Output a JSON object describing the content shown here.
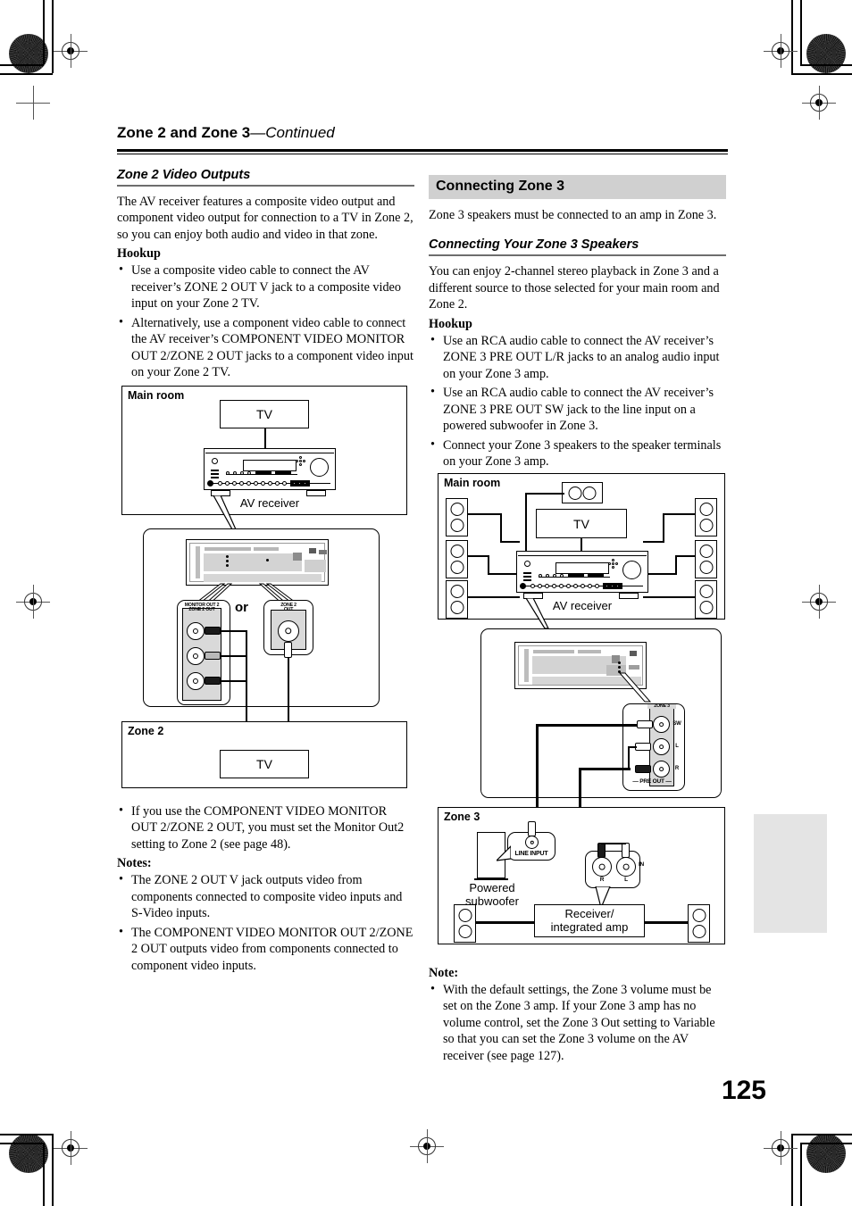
{
  "header": {
    "title_bold": "Zone 2 and Zone 3",
    "title_italic": "—Continued"
  },
  "left_column": {
    "section_title": "Zone 2 Video Outputs",
    "intro": "The AV receiver features a composite video output and component video output for connection to a TV in Zone 2, so you can enjoy both audio and video in that zone.",
    "hookup_label": "Hookup",
    "hookup_items": [
      "Use a composite video cable to connect the AV receiver’s ZONE 2 OUT V jack to a composite video input on your Zone 2 TV.",
      "Alternatively, use a component video cable to connect the AV receiver’s COMPONENT VIDEO MONITOR OUT 2/ZONE 2 OUT jacks to a component video input on your Zone 2 TV."
    ],
    "after_diagram_items": [
      "If you use the COMPONENT VIDEO MONITOR OUT 2/ZONE 2 OUT, you must set the Monitor Out2 setting to Zone 2 (see page 48)."
    ],
    "notes_label": "Notes:",
    "notes_items": [
      "The ZONE 2 OUT V jack outputs video from components connected to composite video inputs and S-Video inputs.",
      "The COMPONENT VIDEO MONITOR OUT 2/ZONE 2 OUT outputs video from components connected to component video inputs."
    ]
  },
  "right_column": {
    "box_heading": "Connecting Zone 3",
    "intro": "Zone 3 speakers must be connected to an amp in Zone 3.",
    "section_title": "Connecting Your Zone 3 Speakers",
    "body": "You can enjoy 2-channel stereo playback in Zone 3 and a different source to those selected for your main room and Zone 2.",
    "hookup_label": "Hookup",
    "hookup_items": [
      "Use an RCA audio cable to connect the AV receiver’s ZONE 3 PRE OUT L/R jacks to an analog audio input on your Zone 3 amp.",
      "Use an RCA audio cable to connect the AV receiver’s ZONE 3 PRE OUT SW jack to the line input on a powered subwoofer in Zone 3.",
      "Connect your Zone 3 speakers to the speaker terminals on your Zone 3 amp."
    ],
    "note_label": "Note:",
    "note_items": [
      "With the default settings, the Zone 3 volume must be set on the Zone 3 amp. If your Zone 3 amp has no volume control, set the Zone 3 Out setting to Variable so that you can set the Zone 3 volume on the AV receiver (see page 127)."
    ]
  },
  "diagram_left": {
    "main_room_label": "Main room",
    "tv_label": "TV",
    "receiver_caption": "AV receiver",
    "or_label": "or",
    "jack_group_1_line1": "MONITOR OUT 2",
    "jack_group_1_line2": "ZONE 2 OUT",
    "jack_group_2_line1": "ZONE 2",
    "jack_group_2_line2": "OUT",
    "zone_label": "Zone 2",
    "zone_tv_label": "TV"
  },
  "diagram_right": {
    "main_room_label": "Main room",
    "tv_label": "TV",
    "receiver_caption": "AV receiver",
    "zone3_jack_group": "ZONE 3",
    "jack_sw": "SW",
    "jack_l": "L",
    "jack_r": "R",
    "pre_out_label": "— PRE OUT —",
    "zone_label": "Zone 3",
    "line_input_label": "LINE INPUT",
    "subwoofer_caption_line1": "Powered",
    "subwoofer_caption_line2": "subwoofer",
    "amp_in_label": "IN",
    "amp_r_label": "R",
    "amp_l_label": "L",
    "amp_caption_line1": "Receiver/",
    "amp_caption_line2": "integrated amp"
  },
  "footer": {
    "page_number": "125"
  },
  "colors": {
    "heading_bg": "#d0d0d0",
    "rule": "#000000",
    "subrule": "#6d6d6d",
    "tab": "#e4e4e4"
  }
}
